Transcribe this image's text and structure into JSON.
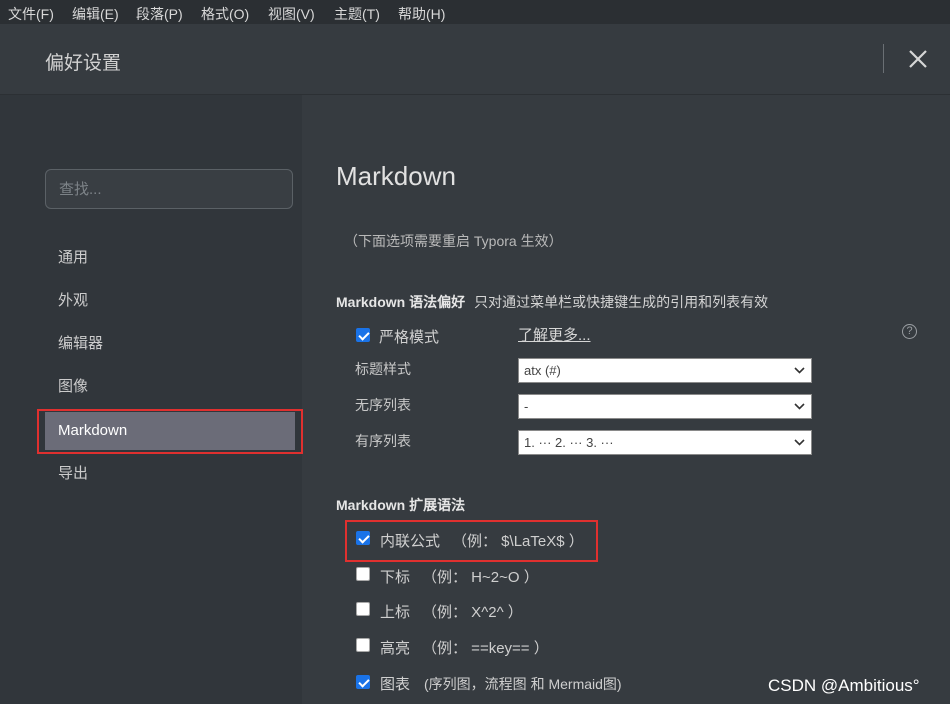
{
  "menubar": {
    "file": "文件(F)",
    "edit": "编辑(E)",
    "paragraph": "段落(P)",
    "format": "格式(O)",
    "view": "视图(V)",
    "theme": "主题(T)",
    "help": "帮助(H)"
  },
  "dialog": {
    "title": "偏好设置"
  },
  "sidebar": {
    "search_placeholder": "查找...",
    "items": [
      "通用",
      "外观",
      "编辑器",
      "图像",
      "Markdown",
      "导出"
    ],
    "active_item": "Markdown"
  },
  "content": {
    "title": "Markdown",
    "restart_note": "（下面选项需要重启 Typora 生效）",
    "syntax_section": {
      "title": "Markdown 语法偏好",
      "description": "只对通过菜单栏或快捷键生成的引用和列表有效",
      "strict_mode": {
        "label": "严格模式",
        "checked": true
      },
      "learn_more": "了解更多...",
      "heading_style": {
        "label": "标题样式",
        "value": "atx (#)"
      },
      "unordered_list": {
        "label": "无序列表",
        "value": "-"
      },
      "ordered_list": {
        "label": "有序列表",
        "value": "1. ··· 2. ··· 3. ···"
      }
    },
    "extended_section": {
      "title": "Markdown 扩展语法",
      "options": [
        {
          "label": "内联公式",
          "example": "（例： $\\LaTeX$ ）",
          "checked": true
        },
        {
          "label": "下标",
          "example": "（例： H~2~O ）",
          "checked": false
        },
        {
          "label": "上标",
          "example": "（例： X^2^ ）",
          "checked": false
        },
        {
          "label": "高亮",
          "example": "（例： ==key== ）",
          "checked": false
        },
        {
          "label": "图表",
          "example": "(序列图，流程图 和 Mermaid图)",
          "checked": true
        }
      ]
    }
  },
  "watermark": "CSDN @Ambitious°",
  "colors": {
    "highlight_box": "#e0302f",
    "checkbox_on": "#1a73e8",
    "active_nav_bg": "#6b6c78"
  }
}
